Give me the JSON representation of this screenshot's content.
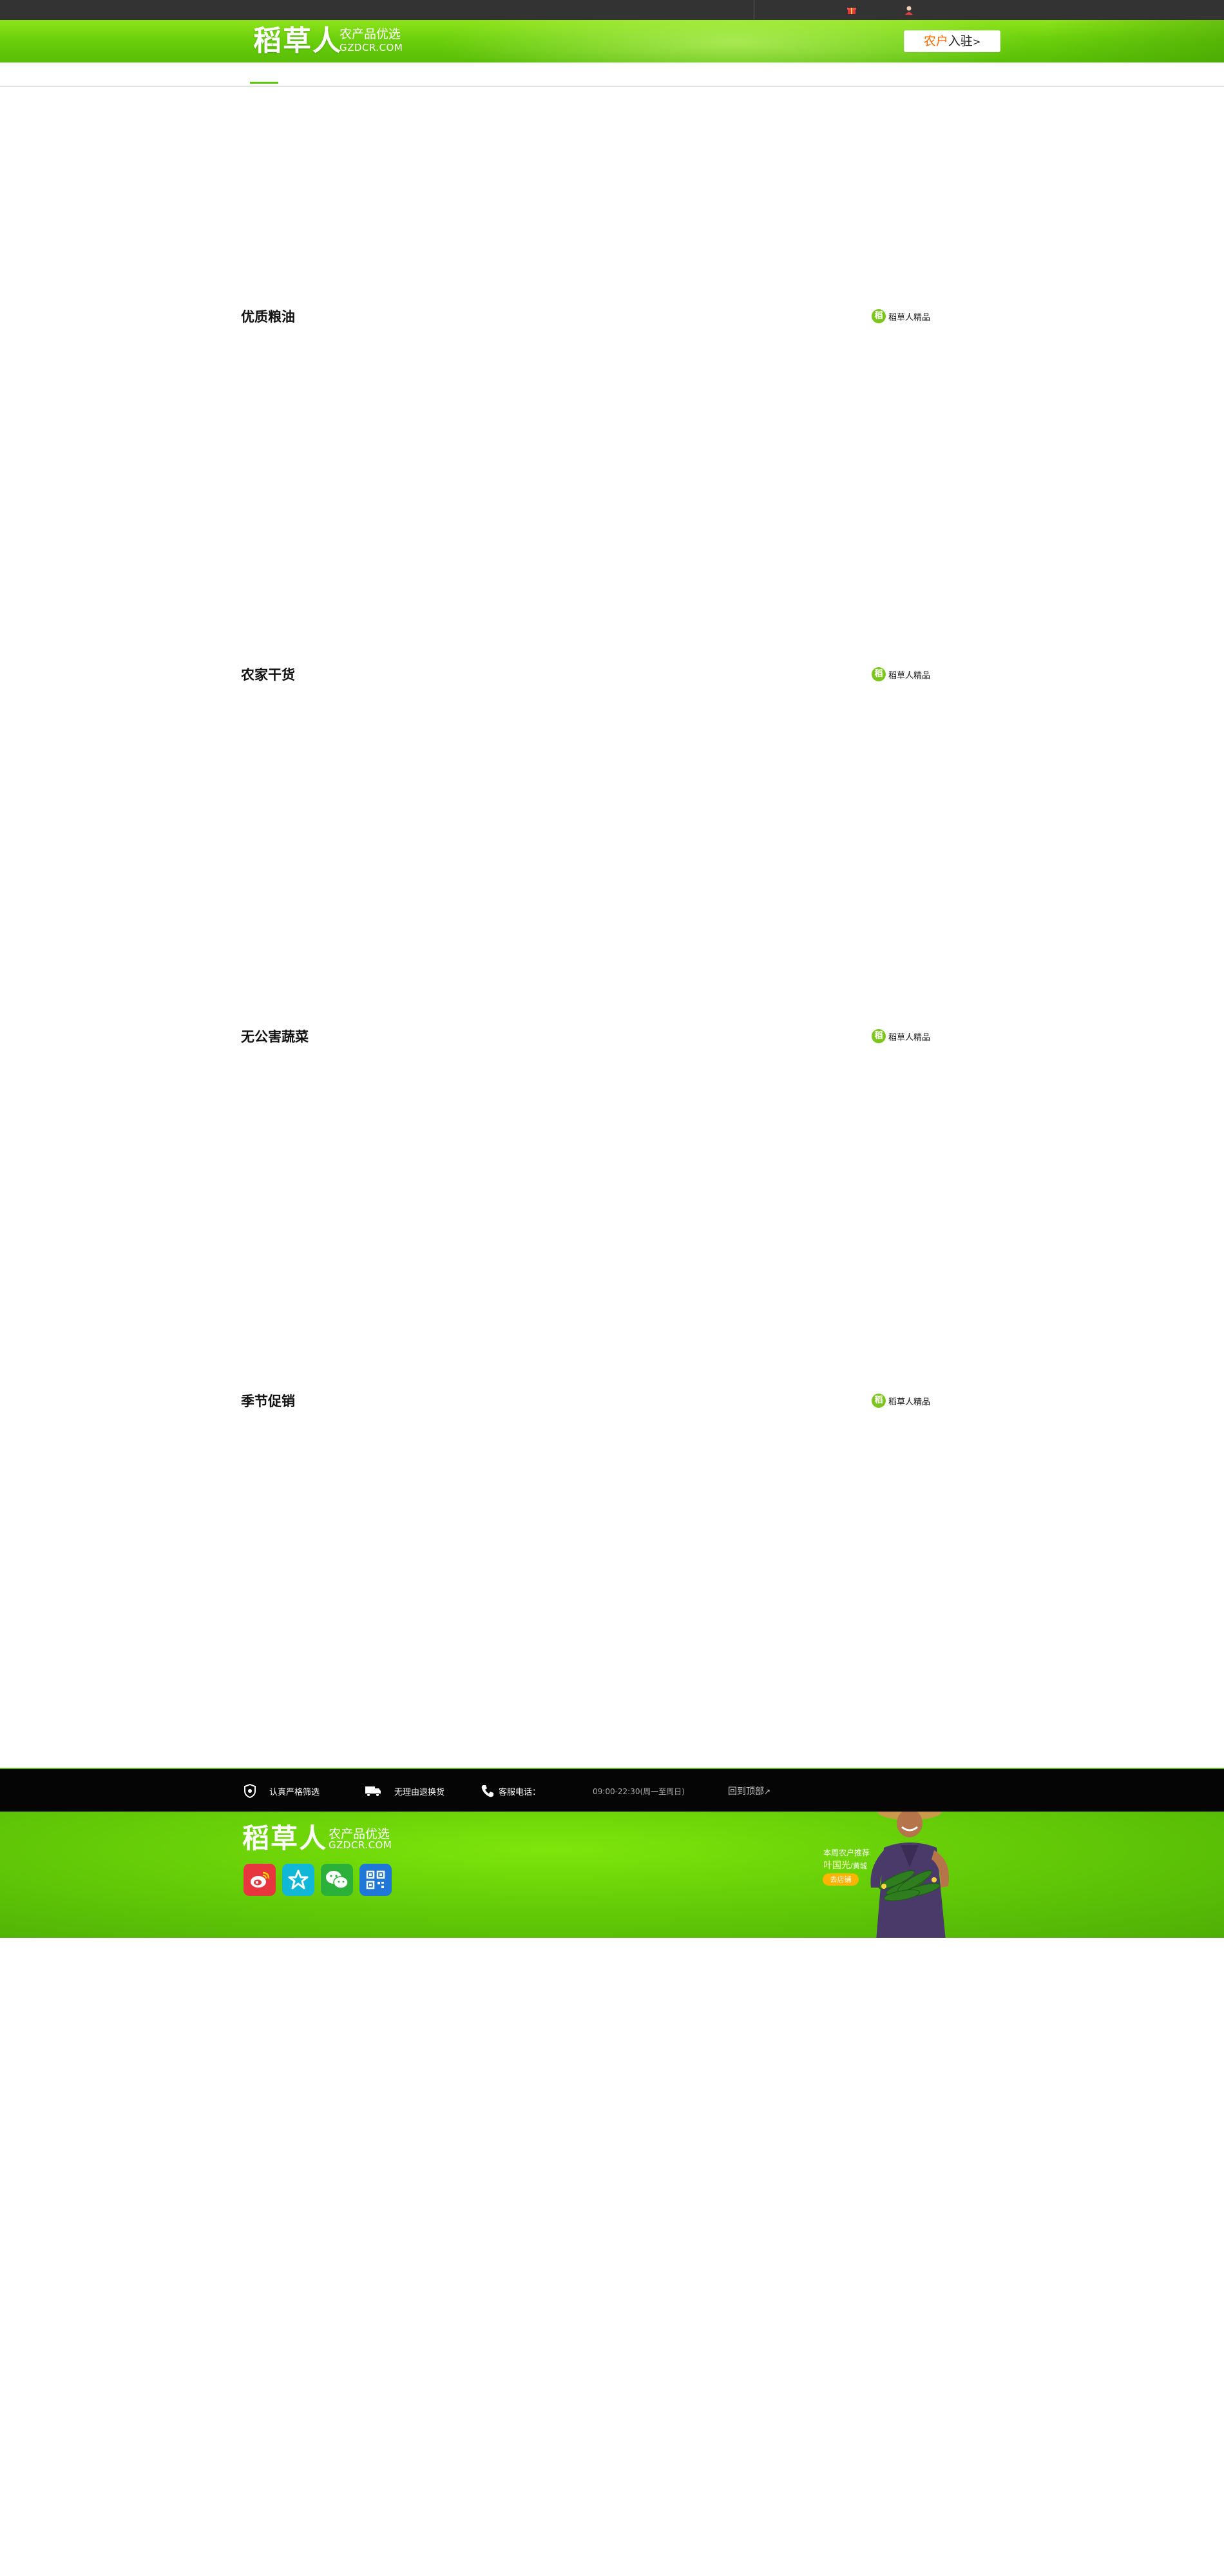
{
  "header": {
    "logo_main": "稻草人",
    "logo_sub1": "农产品优选",
    "logo_sub2": "GZDCR.COM",
    "join_part1": "农户",
    "join_part2": "入驻",
    "join_arrow": ">"
  },
  "sections": [
    {
      "title": "优质粮油",
      "badge_icon_char": "稻",
      "badge_text": "稻草人精品"
    },
    {
      "title": "农家干货",
      "badge_icon_char": "稻",
      "badge_text": "稻草人精品"
    },
    {
      "title": "无公害蔬菜",
      "badge_icon_char": "稻",
      "badge_text": "稻草人精品"
    },
    {
      "title": "季节促销",
      "badge_icon_char": "稻",
      "badge_text": "稻草人精品"
    }
  ],
  "footer_bar": {
    "quality": "认真严格筛选",
    "shipping": "无理由退换货",
    "phone_label": "客服电话：",
    "hours": "09:00-22:30(周一至周日)",
    "back_to_top": "回到顶部"
  },
  "footer": {
    "logo_main": "稻草人",
    "logo_sub1": "农产品优选",
    "logo_sub2": "GZDCR.COM",
    "social_icons": [
      "weibo-icon",
      "star-icon",
      "wechat-icon",
      "qrcode-icon"
    ],
    "farmer_title": "本周农户推荐",
    "farmer_name": "叶国光",
    "farmer_loc": "/黄城",
    "farmer_button": "去店铺"
  },
  "colors": {
    "topbar": "#333333",
    "brand_green": "#6cd00c",
    "accent_orange": "#ff6a00",
    "footer_black": "#050505"
  }
}
